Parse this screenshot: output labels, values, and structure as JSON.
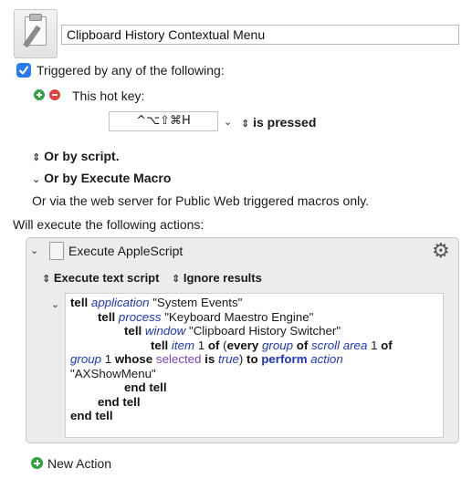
{
  "macro": {
    "title": "Clipboard History Contextual Menu"
  },
  "trigger": {
    "enabled_label": "Triggered by any of the following:",
    "hotkey_label": "This hot key:",
    "hotkey_value": "^⌥⇧⌘H",
    "hotkey_mode": "is pressed",
    "or_script": "Or by script.",
    "or_execute_macro": "Or by Execute Macro",
    "web_server_note": "Or via the web server for Public Web triggered macros only."
  },
  "actions": {
    "header": "Will execute the following actions:",
    "action_title": "Execute AppleScript",
    "script_mode": "Execute text script",
    "results_mode": "Ignore results",
    "new_action": "New Action"
  },
  "script": {
    "l1_tell": "tell",
    "l1_app": "application",
    "l1_str": "\"System Events\"",
    "l2_tell": "tell",
    "l2_proc": "process",
    "l2_str": "\"Keyboard Maestro Engine\"",
    "l3_tell": "tell",
    "l3_win": "window",
    "l3_str": "\"Clipboard History Switcher\"",
    "l4_tell": "tell",
    "l4_item": "item",
    "l4_one": "1",
    "l4_of": "of",
    "l4_paren": "(",
    "l4_every": "every",
    "l4_group": "group",
    "l4_of2": "of",
    "l4_scroll": "scroll area",
    "l4_one2": "1",
    "l4_of3": "of",
    "l5_group": "group",
    "l5_one": "1",
    "l5_whose": "whose",
    "l5_selected": "selected",
    "l5_is": "is",
    "l5_true": "true",
    "l5_to": "to",
    "l5_perform": "perform",
    "l5_action": "action",
    "l6_str": "\"AXShowMenu\"",
    "l7": "end tell",
    "l8": "end tell",
    "l9": "end tell"
  }
}
